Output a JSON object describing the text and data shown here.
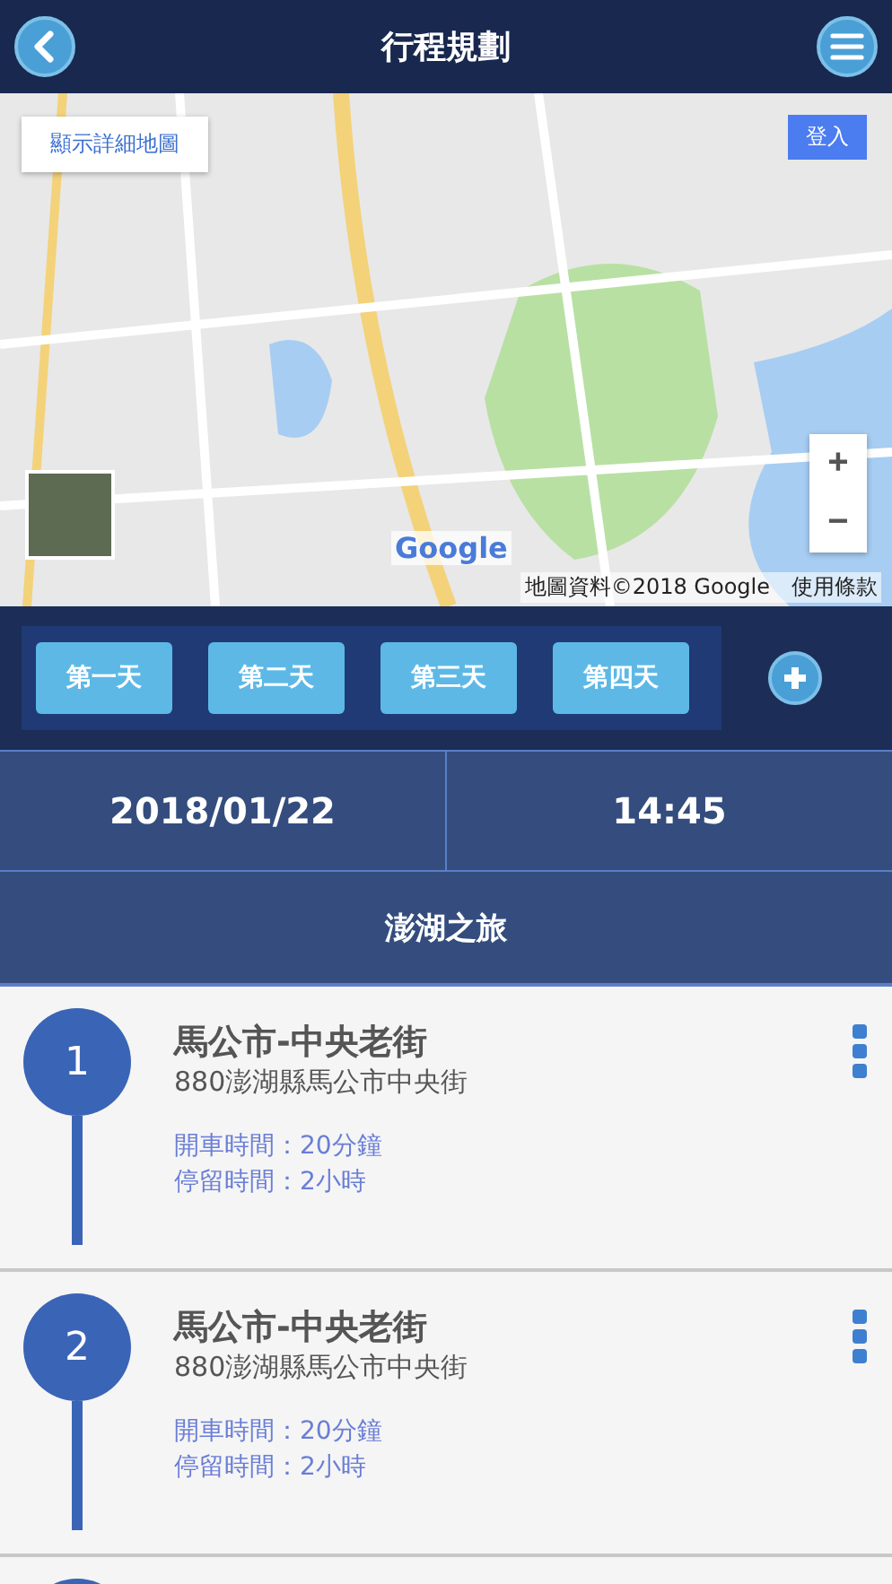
{
  "header": {
    "title": "行程規劃"
  },
  "map": {
    "detail_button": "顯示詳細地圖",
    "sign_in_button": "登入",
    "zoom_in": "+",
    "zoom_out": "−",
    "logo": "Google",
    "attribution": "地圖資料©2018 Google",
    "terms_link": "使用條款"
  },
  "day_tabs": [
    {
      "label": "第一天"
    },
    {
      "label": "第二天"
    },
    {
      "label": "第三天"
    },
    {
      "label": "第四天"
    }
  ],
  "date": "2018/01/22",
  "time": "14:45",
  "trip_title": "澎湖之旅",
  "stops": [
    {
      "number": "1",
      "name": "馬公市-中央老街",
      "address": "880澎湖縣馬公市中央街",
      "drive_time": "開車時間：20分鐘",
      "stay_time": "停留時間：2小時"
    },
    {
      "number": "2",
      "name": "馬公市-中央老街",
      "address": "880澎湖縣馬公市中央街",
      "drive_time": "開車時間：20分鐘",
      "stay_time": "停留時間：2小時"
    }
  ]
}
